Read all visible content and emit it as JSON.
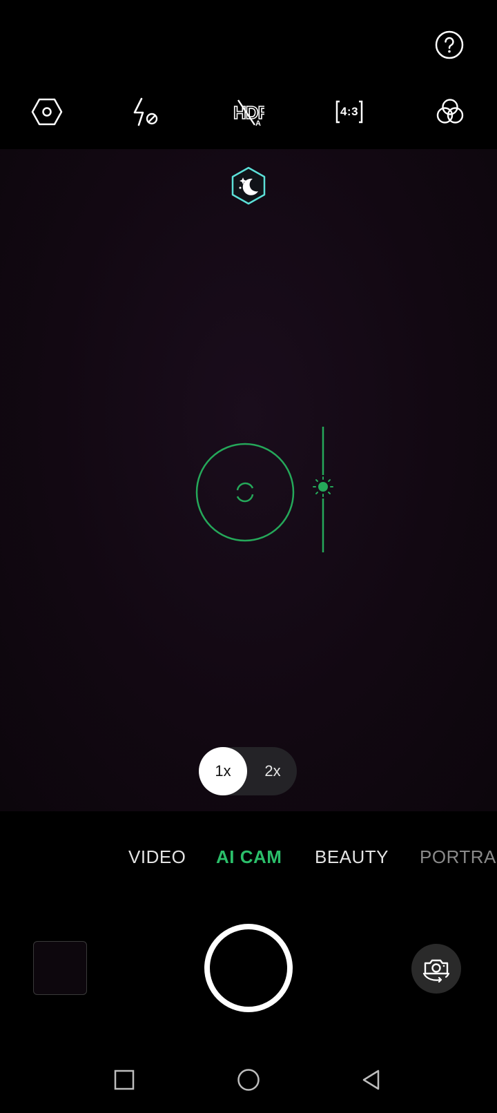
{
  "top_bar": {
    "help_icon": "help-circle-icon"
  },
  "toolbar": {
    "items": [
      {
        "icon": "settings-hexagon-icon"
      },
      {
        "icon": "flash-off-icon"
      },
      {
        "icon": "hdr-auto-off-icon"
      },
      {
        "icon": "aspect-ratio-icon",
        "label": "4:3"
      },
      {
        "icon": "filter-icon"
      }
    ]
  },
  "viewfinder": {
    "scene_icon": "night-mode-icon",
    "focus_icon": "focus-ring-icon",
    "exposure_icon": "exposure-sun-icon",
    "zoom": {
      "options": [
        "1x",
        "2x"
      ],
      "selected": "1x"
    }
  },
  "modes": {
    "items": [
      "VIDEO",
      "AI CAM",
      "BEAUTY",
      "PORTRA"
    ],
    "active": "AI CAM"
  },
  "controls": {
    "gallery_icon": "gallery-thumbnail",
    "shutter_icon": "shutter-button",
    "flip_icon": "switch-camera-icon"
  },
  "navbar": {
    "items": [
      "recent-apps-icon",
      "home-icon",
      "back-icon"
    ]
  },
  "colors": {
    "accent": "#2bbf6a",
    "focus": "#25a85a",
    "scene_badge": "#5ce0d8"
  }
}
